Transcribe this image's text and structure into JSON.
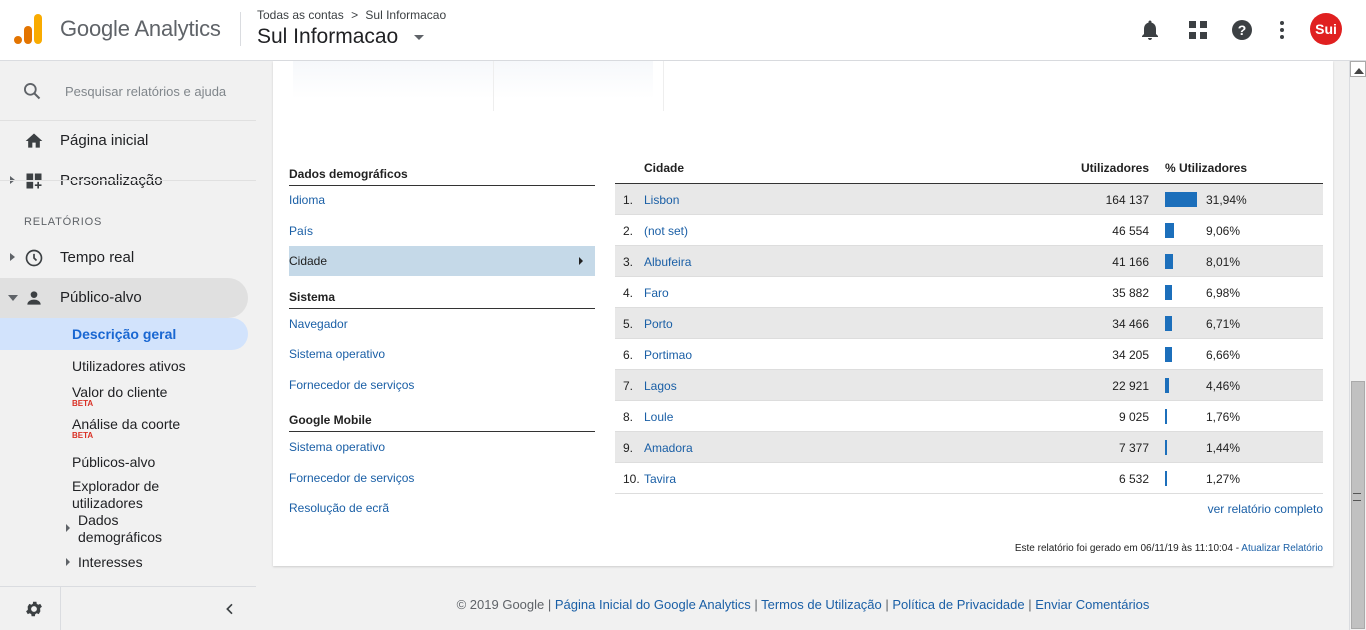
{
  "header": {
    "brand": "Google Analytics",
    "breadcrumb": [
      "Todas as contas",
      ">",
      "Sul Informacao"
    ],
    "account": "Sul Informacao",
    "avatar_text": "Sui"
  },
  "sidebar": {
    "search_placeholder": "Pesquisar relatórios e ajuda",
    "home": "Página inicial",
    "customization": "Personalização",
    "reports_section": "RELATÓRIOS",
    "realtime": "Tempo real",
    "audience": "Público-alvo",
    "audience_items": {
      "overview": "Descrição geral",
      "active_users": "Utilizadores ativos",
      "lifetime_value": "Valor do cliente",
      "cohort": "Análise da coorte",
      "audiences": "Públicos-alvo",
      "explorer_1": "Explorador de",
      "explorer_2": "utilizadores",
      "demo_1": "Dados",
      "demo_2": "demográficos",
      "interests": "Interesses"
    },
    "beta": "BETA"
  },
  "left_panel": {
    "demo_title": "Dados demográficos",
    "demo_links": [
      "Idioma",
      "País"
    ],
    "selected": "Cidade",
    "system_title": "Sistema",
    "system_links": [
      "Navegador",
      "Sistema operativo",
      "Fornecedor de serviços"
    ],
    "mobile_title": "Google Mobile",
    "mobile_links": [
      "Sistema operativo",
      "Fornecedor de serviços",
      "Resolução de ecrã"
    ]
  },
  "table": {
    "col_city": "Cidade",
    "col_users": "Utilizadores",
    "col_pct": "% Utilizadores",
    "rows": [
      {
        "n": "1.",
        "city": "Lisbon",
        "users": "164 137",
        "pct": "31,94%",
        "share": 31.94
      },
      {
        "n": "2.",
        "city": "(not set)",
        "users": "46 554",
        "pct": "9,06%",
        "share": 9.06
      },
      {
        "n": "3.",
        "city": "Albufeira",
        "users": "41 166",
        "pct": "8,01%",
        "share": 8.01
      },
      {
        "n": "4.",
        "city": "Faro",
        "users": "35 882",
        "pct": "6,98%",
        "share": 6.98
      },
      {
        "n": "5.",
        "city": "Porto",
        "users": "34 466",
        "pct": "6,71%",
        "share": 6.71
      },
      {
        "n": "6.",
        "city": "Portimao",
        "users": "34 205",
        "pct": "6,66%",
        "share": 6.66
      },
      {
        "n": "7.",
        "city": "Lagos",
        "users": "22 921",
        "pct": "4,46%",
        "share": 4.46
      },
      {
        "n": "8.",
        "city": "Loule",
        "users": "9 025",
        "pct": "1,76%",
        "share": 1.76
      },
      {
        "n": "9.",
        "city": "Amadora",
        "users": "7 377",
        "pct": "1,44%",
        "share": 1.44
      },
      {
        "n": "10.",
        "city": "Tavira",
        "users": "6 532",
        "pct": "1,27%",
        "share": 1.27
      }
    ],
    "full_report": "ver relatório completo",
    "generated": "Este relatório foi gerado em 06/11/19 às 11:10:04 - ",
    "refresh": "Atualizar Relatório"
  },
  "footer": {
    "copyright": "© 2019 Google",
    "sep": " | ",
    "links": [
      "Página Inicial do Google Analytics",
      "Termos de Utilização",
      "Política de Privacidade",
      "Enviar Comentários"
    ]
  }
}
